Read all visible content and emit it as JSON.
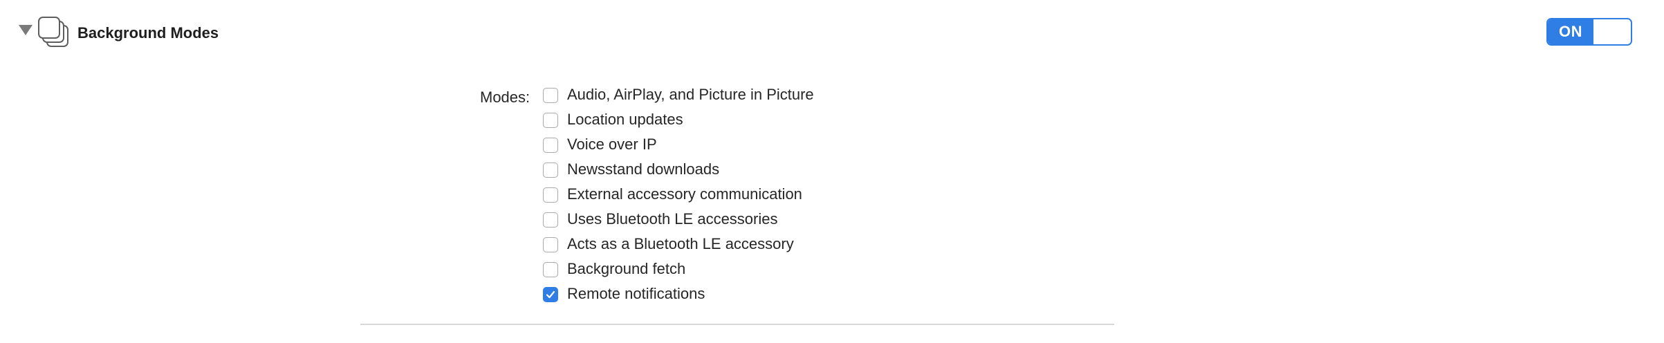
{
  "capability": {
    "title": "Background Modes",
    "icon": "background-modes-icon",
    "toggle": {
      "label": "ON",
      "state": true,
      "accent_color": "#2f7ee6"
    }
  },
  "modes": {
    "label": "Modes:",
    "options": [
      {
        "label": "Audio, AirPlay, and Picture in Picture",
        "checked": false
      },
      {
        "label": "Location updates",
        "checked": false
      },
      {
        "label": "Voice over IP",
        "checked": false
      },
      {
        "label": "Newsstand downloads",
        "checked": false
      },
      {
        "label": "External accessory communication",
        "checked": false
      },
      {
        "label": "Uses Bluetooth LE accessories",
        "checked": false
      },
      {
        "label": "Acts as a Bluetooth LE accessory",
        "checked": false
      },
      {
        "label": "Background fetch",
        "checked": false
      },
      {
        "label": "Remote notifications",
        "checked": true
      }
    ]
  }
}
